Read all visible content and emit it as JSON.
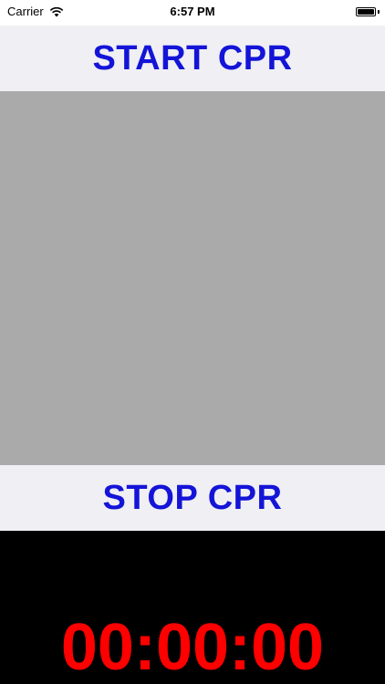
{
  "status_bar": {
    "carrier": "Carrier",
    "time": "6:57 PM",
    "wifi_icon": "wifi-icon",
    "battery_icon": "battery-icon"
  },
  "start_button": {
    "label": "START CPR"
  },
  "stop_button": {
    "label": "STOP CPR"
  },
  "timer": {
    "value": "00:00:00"
  },
  "colors": {
    "button_text": "#1414d8",
    "button_bg": "#efeff4",
    "video_bg": "#aaaaaa",
    "timer_bg": "#000000",
    "timer_text": "#ff0000"
  }
}
